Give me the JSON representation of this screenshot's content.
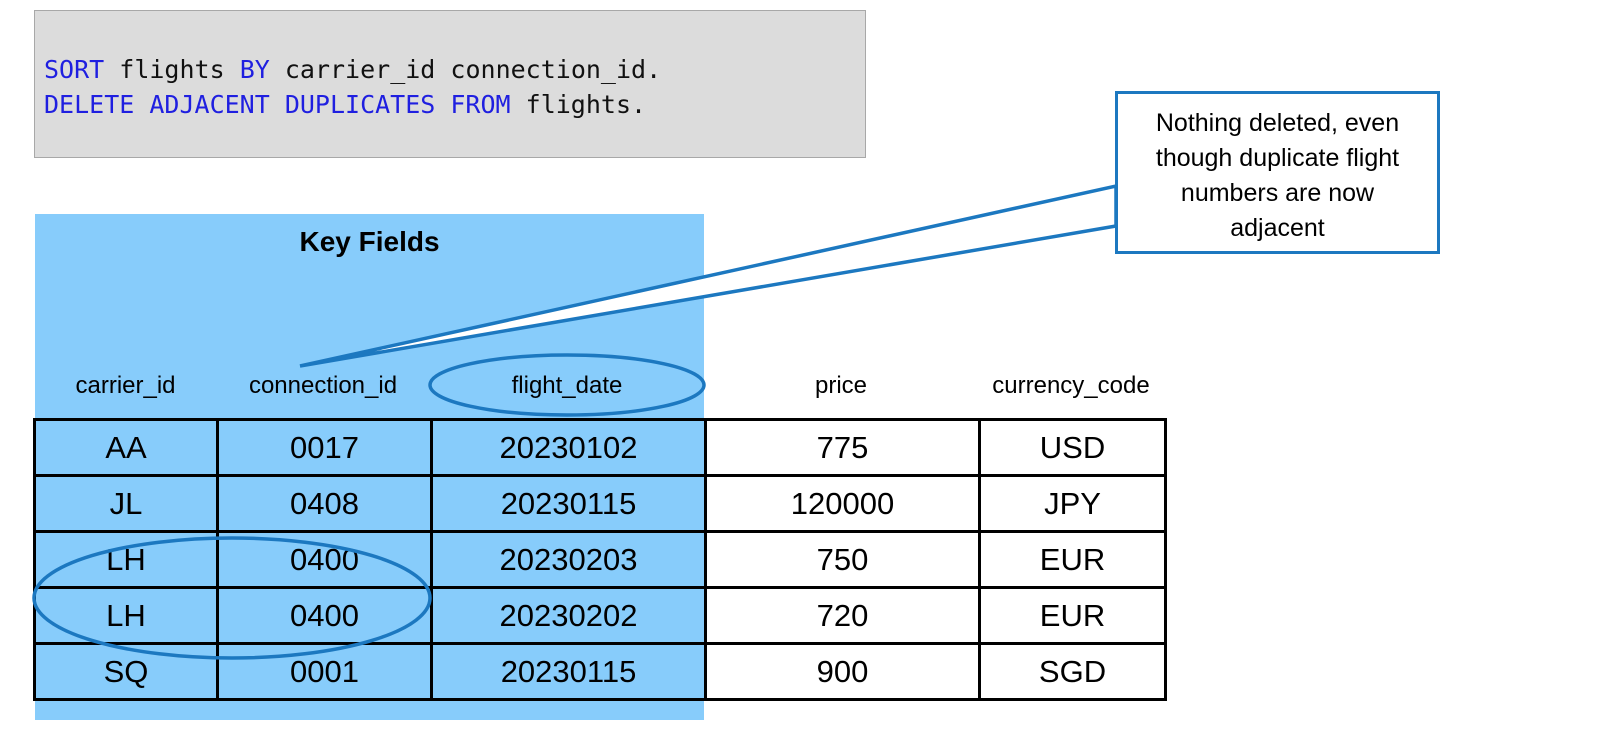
{
  "code": {
    "line1": [
      {
        "text": "SORT",
        "kind": "keyword"
      },
      {
        "text": " flights ",
        "kind": "text"
      },
      {
        "text": "BY",
        "kind": "keyword"
      },
      {
        "text": " carrier_id connection_id.",
        "kind": "text"
      }
    ],
    "line2": [
      {
        "text": "DELETE ADJACENT DUPLICATES FROM",
        "kind": "keyword"
      },
      {
        "text": " flights.",
        "kind": "text"
      }
    ]
  },
  "key_fields_title": "Key Fields",
  "columns": [
    "carrier_id",
    "connection_id",
    "flight_date",
    "price",
    "currency_code"
  ],
  "rows": [
    [
      "AA",
      "0017",
      "20230102",
      "775",
      "USD"
    ],
    [
      "JL",
      "0408",
      "20230115",
      "120000",
      "JPY"
    ],
    [
      "LH",
      "0400",
      "20230203",
      "750",
      "EUR"
    ],
    [
      "LH",
      "0400",
      "20230202",
      "720",
      "EUR"
    ],
    [
      "SQ",
      "0001",
      "20230115",
      "900",
      "SGD"
    ]
  ],
  "callout": "Nothing deleted, even though duplicate flight numbers are now adjacent",
  "colors": {
    "keyword": "#1f1fe0",
    "key_fill": "#87ccfb",
    "highlight": "#1c78c0",
    "code_bg": "#dcdcdc"
  }
}
